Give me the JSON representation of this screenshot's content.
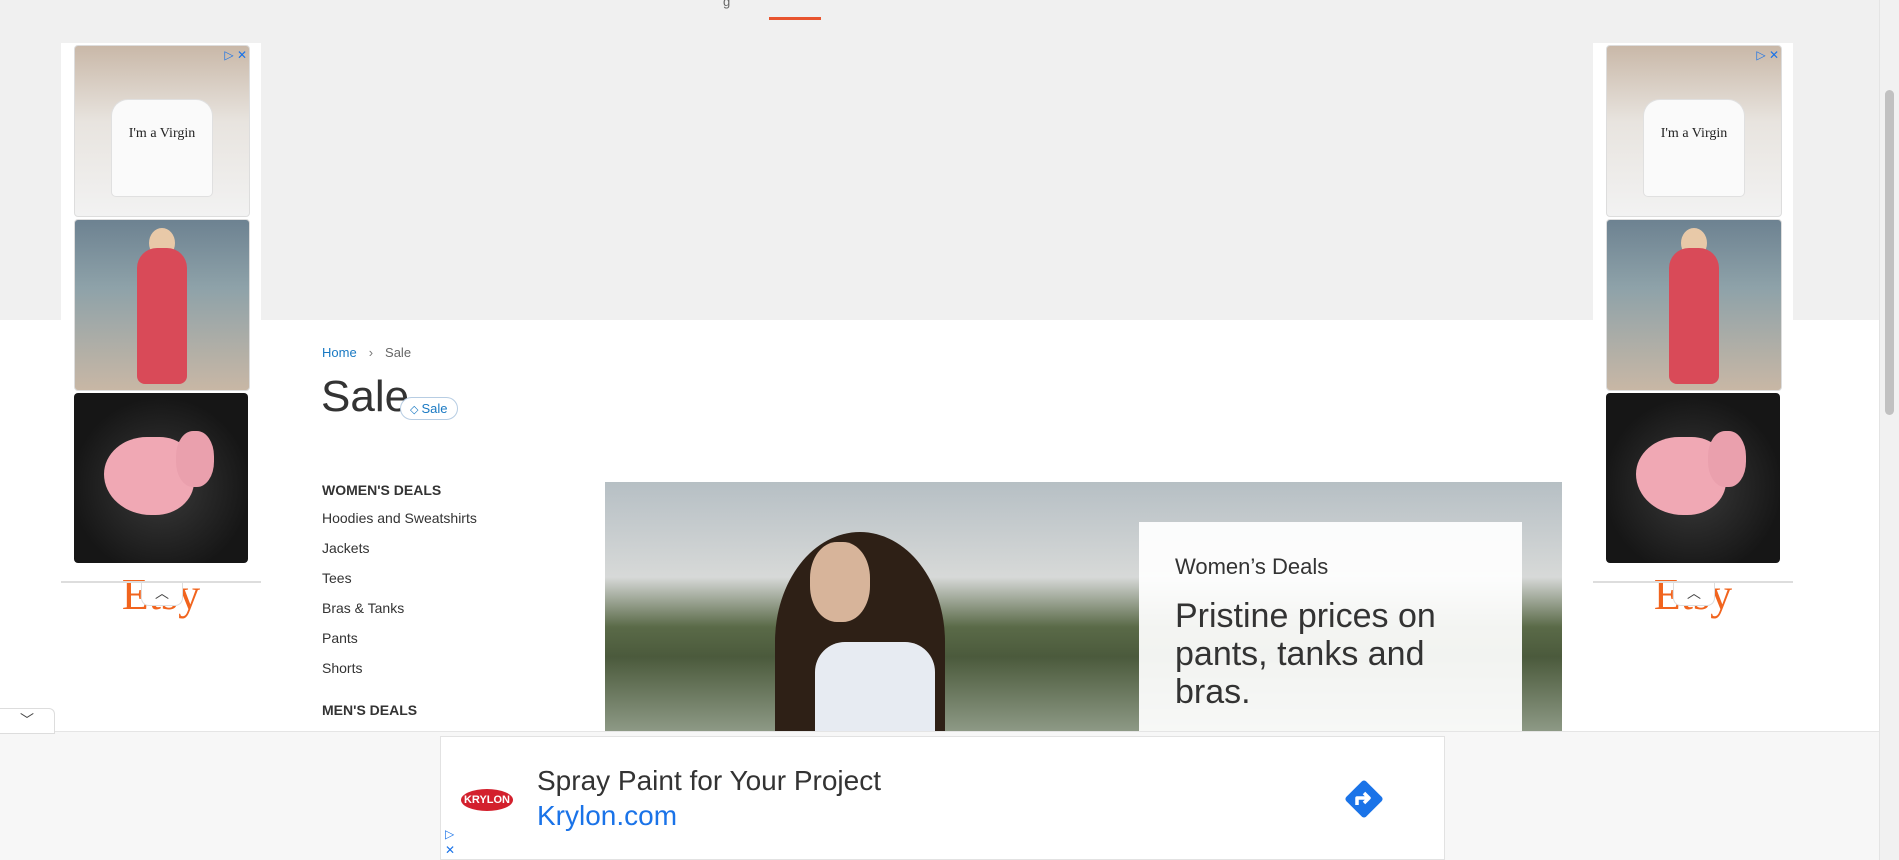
{
  "nav": {
    "fragment": "g"
  },
  "side_ads": {
    "tshirt_text": "I'm a Virgin",
    "brand": "Etsy",
    "ad_choices_icons": [
      "adchoices-icon",
      "close-icon"
    ],
    "collapse_icon": "chevron-up-icon"
  },
  "breadcrumb": {
    "home": "Home",
    "separator": "›",
    "current": "Sale"
  },
  "page": {
    "title": "Sale",
    "badge": "Sale"
  },
  "categories": {
    "womens_heading": "WOMEN'S DEALS",
    "womens_items": [
      "Hoodies and Sweatshirts",
      "Jackets",
      "Tees",
      "Bras & Tanks",
      "Pants",
      "Shorts"
    ],
    "mens_heading": "MEN'S DEALS"
  },
  "hero": {
    "eyebrow": "Women’s Deals",
    "headline": "Pristine prices on pants, tanks and bras."
  },
  "bottom_ad": {
    "logo": "KRYLON",
    "title": "Spray Paint for Your Project",
    "domain": "Krylon.com"
  },
  "colors": {
    "accent": "#e8542e",
    "link": "#1979c3",
    "etsy": "#f1641e",
    "ad_blue": "#1a73e8"
  }
}
